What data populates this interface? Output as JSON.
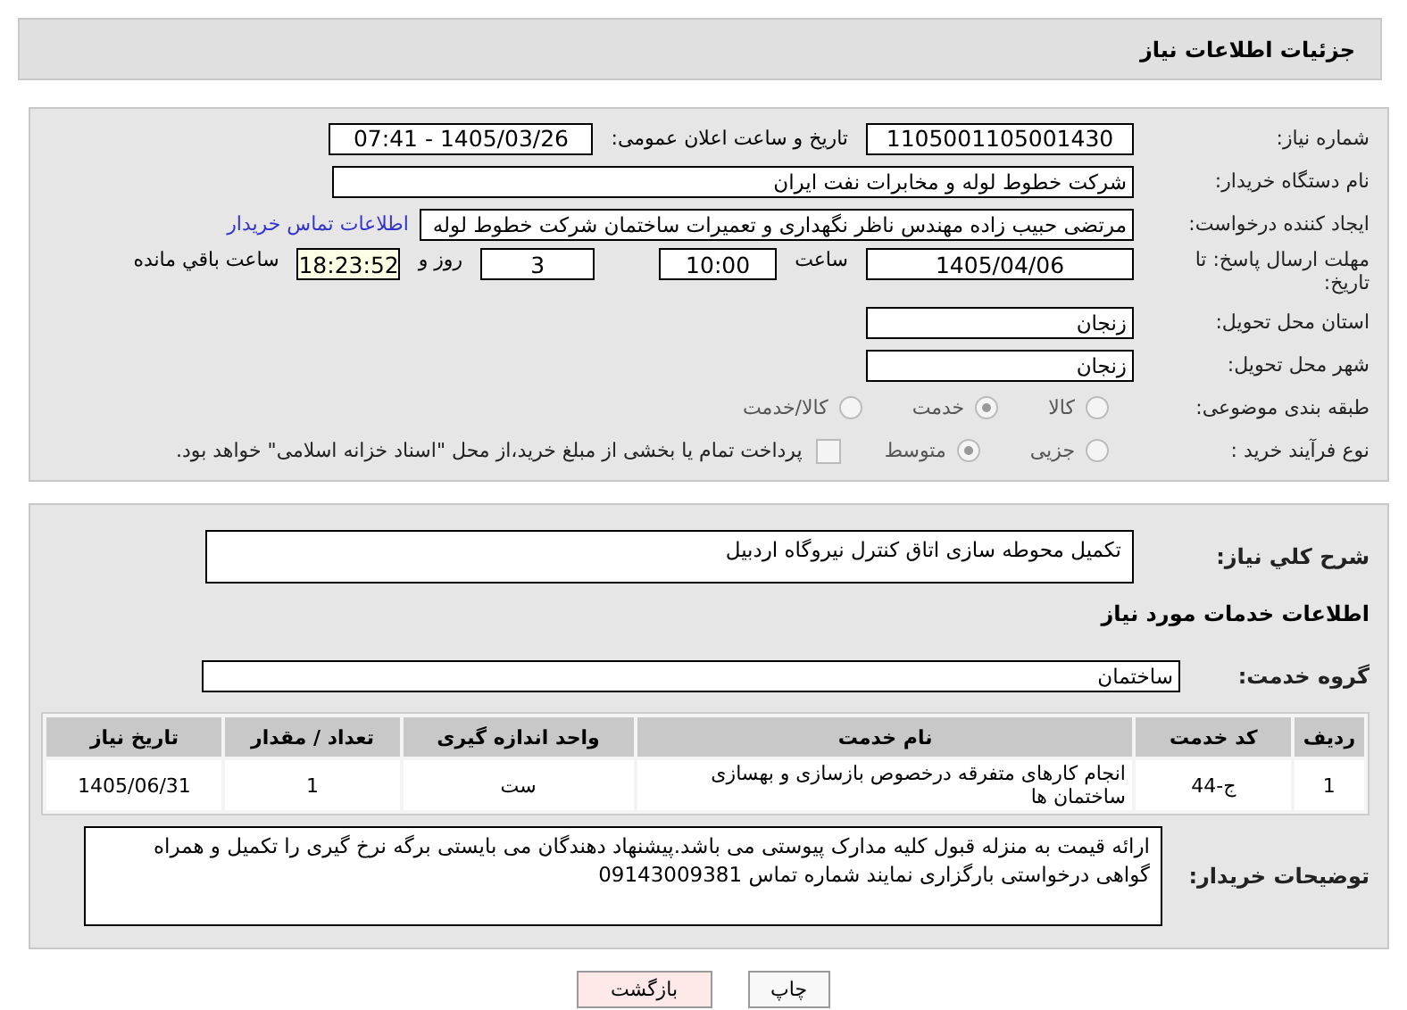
{
  "header": {
    "title": "جزئیات اطلاعات نیاز"
  },
  "details": {
    "need_number": {
      "label": "شماره نیاز:",
      "value": "1105001105001430"
    },
    "announce": {
      "label": "تاریخ و ساعت اعلان عمومی:",
      "value": "1405/03/26 - 07:41"
    },
    "buyer_org": {
      "label": "نام دستگاه خریدار:",
      "value": "شرکت خطوط لوله و مخابرات نفت ایران"
    },
    "creator": {
      "label": "ایجاد کننده درخواست:",
      "value": "مرتضی حبیب زاده مهندس ناظر نگهداری و تعمیرات ساختمان شرکت خطوط لوله",
      "link": "اطلاعات تماس خریدار"
    },
    "deadline": {
      "label": "مهلت ارسال پاسخ: تا تاریخ:",
      "date": "1405/04/06",
      "time_label": "ساعت",
      "time": "10:00",
      "days": "3",
      "days_label": "روز و",
      "remaining": "18:23:52",
      "remaining_label": "ساعت باقي مانده"
    },
    "province": {
      "label": "استان محل تحویل:",
      "value": "زنجان"
    },
    "city": {
      "label": "شهر محل تحویل:",
      "value": "زنجان"
    },
    "category": {
      "label": "طبقه بندی موضوعی:",
      "options": [
        {
          "label": "کالا",
          "selected": false
        },
        {
          "label": "خدمت",
          "selected": true
        },
        {
          "label": "کالا/خدمت",
          "selected": false
        }
      ]
    },
    "process": {
      "label": "نوع فرآیند خرید :",
      "options": [
        {
          "label": "جزیی",
          "selected": false
        },
        {
          "label": "متوسط",
          "selected": true
        }
      ],
      "treasury": {
        "checked": false,
        "text": "پرداخت تمام یا بخشی از مبلغ خرید،از محل \"اسناد خزانه اسلامی\" خواهد بود."
      }
    }
  },
  "services": {
    "description": {
      "label": "شرح کلي نیاز:",
      "value": "تکمیل محوطه سازی اتاق کنترل نیروگاه اردبیل"
    },
    "heading": "اطلاعات خدمات مورد نیاز",
    "group": {
      "label": "گروه خدمت:",
      "value": "ساختمان"
    },
    "table": {
      "columns": [
        "ردیف",
        "کد خدمت",
        "نام خدمت",
        "واحد اندازه گیری",
        "تعداد / مقدار",
        "تاریخ نیاز"
      ],
      "rows": [
        [
          "1",
          "ج-44",
          "انجام کارهای متفرقه درخصوص بازسازی و بهسازی ساختمان ها",
          "ست",
          "1",
          "1405/06/31"
        ]
      ]
    },
    "notes": {
      "label": "توضیحات خریدار:",
      "value": "ارائه قیمت به منزله قبول کلیه مدارک پیوستی می باشد.پیشنهاد دهندگان می بایستی برگه نرخ گیری را تکمیل  و همراه گواهی درخواستی بارگزاری نمایند شماره تماس 09143009381"
    }
  },
  "buttons": [
    "چاپ",
    "بازگشت"
  ]
}
